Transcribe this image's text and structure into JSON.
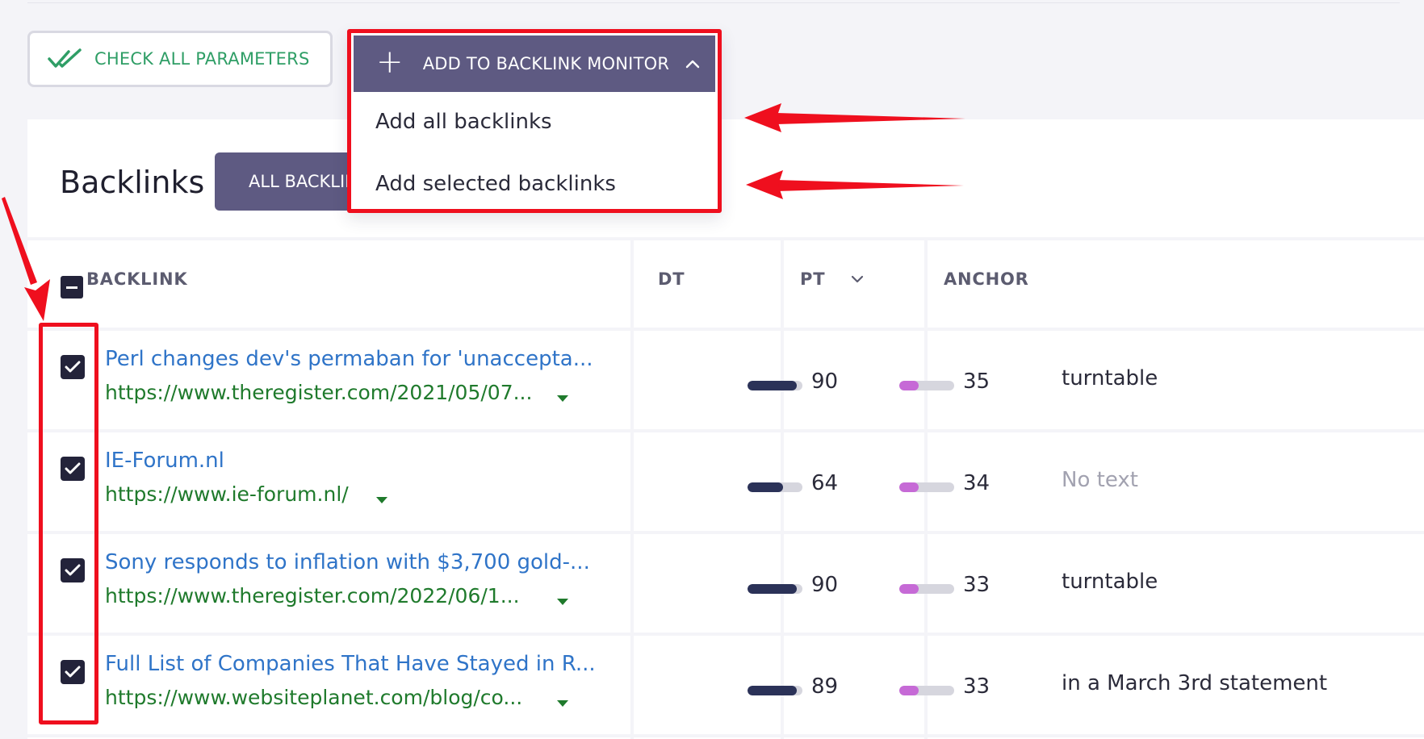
{
  "toolbar": {
    "check_label": "CHECK ALL PARAMETERS",
    "add_label": "ADD TO BACKLINK MONITOR",
    "menu": [
      "Add all backlinks",
      "Add selected backlinks"
    ]
  },
  "section": {
    "title": "Backlinks",
    "tab_label": "ALL BACKLINKS"
  },
  "table": {
    "headers": {
      "backlink": "BACKLINK",
      "dt": "DT",
      "pt": "PT",
      "anchor": "ANCHOR"
    },
    "rows": [
      {
        "title": "Perl changes dev's permaban for 'unaccepta...",
        "url": "https://www.theregister.com/2021/05/07...",
        "dt": "90",
        "pt": "35",
        "anchor": "turntable",
        "checked": true
      },
      {
        "title": "IE-Forum.nl",
        "url": "https://www.ie-forum.nl/",
        "dt": "64",
        "pt": "34",
        "anchor": "No text",
        "checked": true
      },
      {
        "title": "Sony responds to inflation with $3,700 gold-...",
        "url": "https://www.theregister.com/2022/06/1...",
        "dt": "90",
        "pt": "33",
        "anchor": "turntable",
        "checked": true
      },
      {
        "title": "Full List of Companies That Have Stayed in R...",
        "url": "https://www.websiteplanet.com/blog/co...",
        "dt": "89",
        "pt": "33",
        "anchor": "in a March 3rd statement",
        "checked": true
      }
    ]
  },
  "colors": {
    "accent": "#5e5a82",
    "link": "#2f74c8",
    "url": "#1f7a2c",
    "check_green": "#2f9e66",
    "dt_fill": "#2b3258",
    "pt_fill": "#c66ad6",
    "annotation": "#ef0f1e"
  },
  "icons": [
    "double-check-icon",
    "plus-icon",
    "chevron-up-icon",
    "chevron-down-icon",
    "checkbox-checked-icon",
    "checkbox-indeterminate-icon",
    "caret-down-icon"
  ]
}
